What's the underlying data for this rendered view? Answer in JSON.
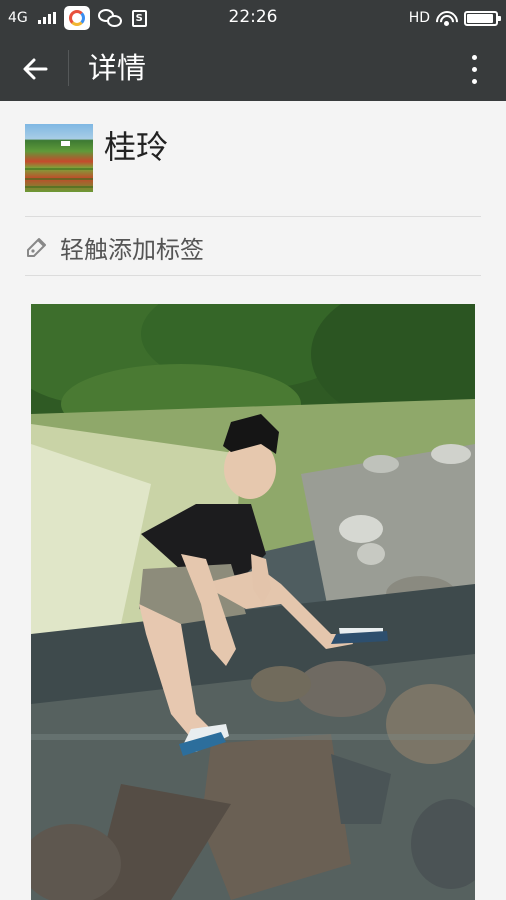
{
  "status_bar": {
    "network": "4G",
    "time": "22:26",
    "hd": "HD",
    "battery_level": 0.92,
    "icons": [
      "signal-icon",
      "app-icon",
      "wechat-icon",
      "sim-icon",
      "wifi-icon",
      "battery-icon"
    ]
  },
  "header": {
    "title": "详情",
    "back_icon": "back-arrow-icon",
    "more_icon": "more-vertical-icon"
  },
  "profile": {
    "name": "桂玲",
    "avatar_icon": "avatar-image"
  },
  "tag": {
    "label": "轻触添加标签",
    "icon": "pencil-tag-icon"
  },
  "colors": {
    "bar_bg": "#383b3c",
    "page_bg": "#f4f4f4",
    "text_dark": "#222222",
    "text_mid": "#555555",
    "divider": "#dcdcdc"
  }
}
